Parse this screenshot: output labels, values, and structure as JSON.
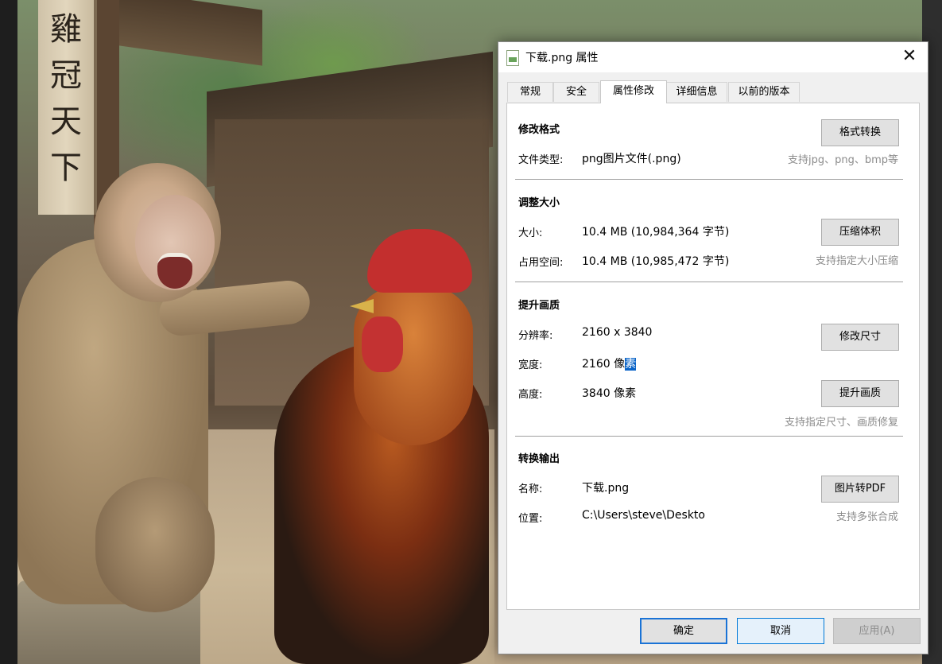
{
  "background": {
    "sign_text": "雞冠天下"
  },
  "dialog": {
    "title": "下载.png 属性",
    "close_glyph": "✕",
    "tabs": [
      {
        "label": "常规"
      },
      {
        "label": "安全"
      },
      {
        "label": "属性修改",
        "active": true
      },
      {
        "label": "详细信息"
      },
      {
        "label": "以前的版本"
      }
    ],
    "format": {
      "title": "修改格式",
      "button": "格式转换",
      "file_type_label": "文件类型:",
      "file_type_value": "png图片文件(.png)",
      "hint": "支持jpg、png、bmp等"
    },
    "resize": {
      "title": "调整大小",
      "size_label": "大小:",
      "size_value": "10.4 MB (10,984,364 字节)",
      "button": "压缩体积",
      "disk_label": "占用空间:",
      "disk_value": "10.4 MB (10,985,472 字节)",
      "hint": "支持指定大小压缩"
    },
    "quality": {
      "title": "提升画质",
      "resolution_label": "分辨率:",
      "resolution_value": "2160 x 3840",
      "resize_button": "修改尺寸",
      "width_label": "宽度:",
      "width_value_main": "2160 像",
      "width_value_selected": "素",
      "height_label": "高度:",
      "height_value": "3840 像素",
      "enhance_button": "提升画质",
      "hint": "支持指定尺寸、画质修复"
    },
    "export": {
      "title": "转换输出",
      "name_label": "名称:",
      "name_value": "下载.png",
      "pdf_button": "图片转PDF",
      "location_label": "位置:",
      "location_value": "C:\\Users\\steve\\Desktop",
      "hint": "支持多张合成"
    },
    "footer": {
      "ok": "确定",
      "cancel": "取消",
      "apply": "应用(A)"
    }
  }
}
